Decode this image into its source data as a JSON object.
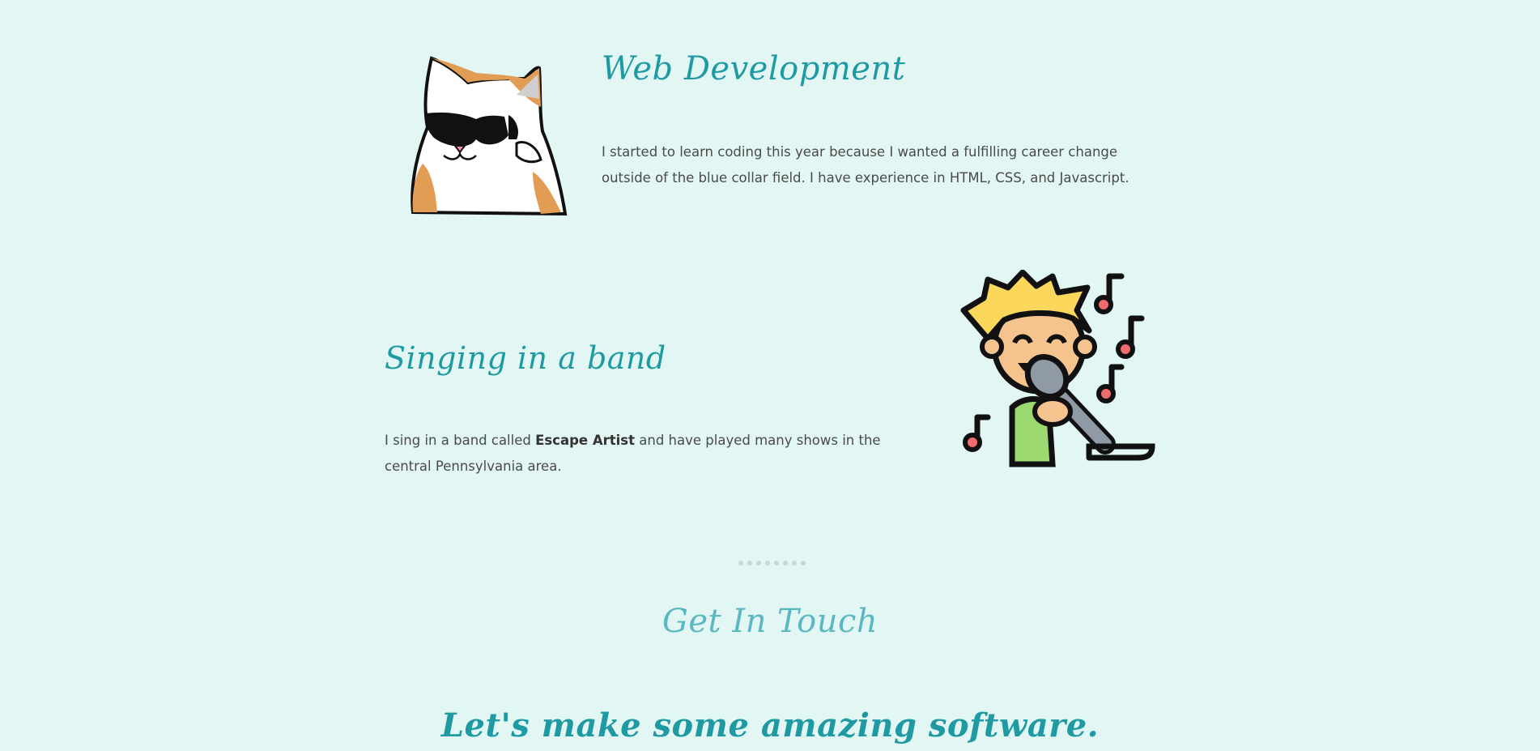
{
  "sections": {
    "web_dev": {
      "title": "Web Development",
      "text": "I started to learn coding this year because I wanted a fulfilling career change outside of the blue collar field. I have experience in HTML, CSS, and Javascript.",
      "image_icon": "cool-cat-sunglasses-icon"
    },
    "band": {
      "title": "Singing in a band",
      "text_before": "I sing in a band called ",
      "band_name": "Escape Artist",
      "text_after": " and have played many shows in the central Pennsylvania area.",
      "image_icon": "singer-microphone-icon"
    }
  },
  "contact": {
    "title": "Get In Touch"
  },
  "cta": {
    "title": "Let's make some amazing software."
  },
  "colors": {
    "background": "#e2f7f4",
    "accent": "#1f9aa3",
    "accent_light": "#5bb8c1",
    "text": "#4a4a4a"
  }
}
